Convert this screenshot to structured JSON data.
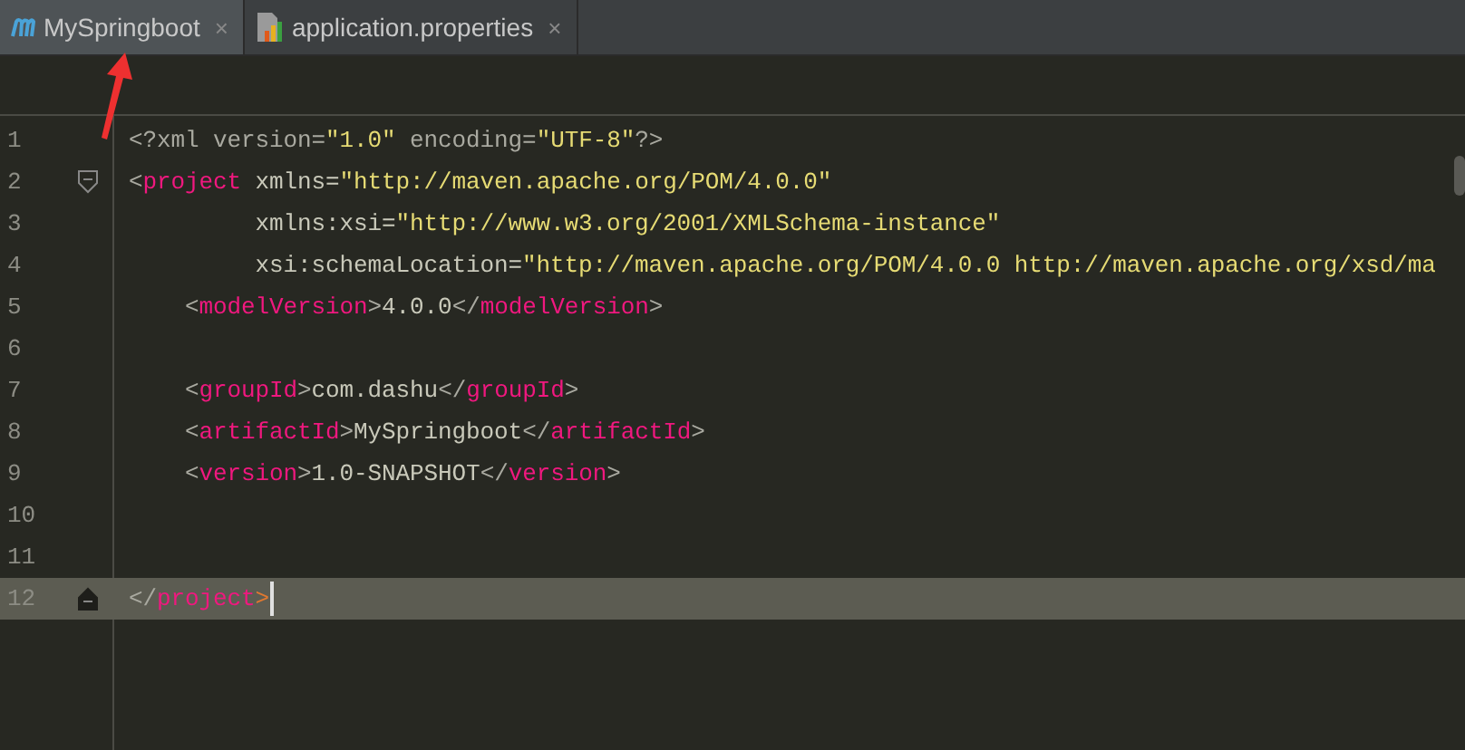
{
  "tabs": [
    {
      "label": "MySpringboot",
      "close": "×",
      "selected": true
    },
    {
      "label": "application.properties",
      "close": "×",
      "selected": false
    }
  ],
  "editor": {
    "lines": [
      {
        "number": "1",
        "current": false,
        "kind": "plain",
        "tokens": [
          {
            "kind": "punct",
            "text": "<?xml version="
          },
          {
            "kind": "string",
            "text": "\"1.0\""
          },
          {
            "kind": "punct",
            "text": " encoding="
          },
          {
            "kind": "string",
            "text": "\"UTF-8\""
          },
          {
            "kind": "punct",
            "text": "?>"
          }
        ]
      },
      {
        "number": "2",
        "current": false,
        "kind": "foldstart",
        "tokens": [
          {
            "kind": "punct",
            "text": "<"
          },
          {
            "kind": "tag",
            "text": "project"
          },
          {
            "kind": "attr",
            "text": " xmlns="
          },
          {
            "kind": "string",
            "text": "\"http://maven.apache.org/POM/4.0.0\""
          }
        ]
      },
      {
        "number": "3",
        "current": false,
        "kind": "plain",
        "tokens": [
          {
            "kind": "attr",
            "text": "         xmlns:xsi="
          },
          {
            "kind": "string",
            "text": "\"http://www.w3.org/2001/XMLSchema-instance\""
          }
        ]
      },
      {
        "number": "4",
        "current": false,
        "kind": "plain",
        "tokens": [
          {
            "kind": "attr",
            "text": "         xsi:schemaLocation="
          },
          {
            "kind": "string",
            "text": "\"http://maven.apache.org/POM/4.0.0 http://maven.apache.org/xsd/ma"
          }
        ]
      },
      {
        "number": "5",
        "current": false,
        "kind": "plain",
        "tokens": [
          {
            "kind": "punct",
            "text": "    <"
          },
          {
            "kind": "tag",
            "text": "modelVersion"
          },
          {
            "kind": "punct",
            "text": ">"
          },
          {
            "kind": "text",
            "text": "4.0.0"
          },
          {
            "kind": "punct",
            "text": "</"
          },
          {
            "kind": "tag",
            "text": "modelVersion"
          },
          {
            "kind": "punct",
            "text": ">"
          }
        ]
      },
      {
        "number": "6",
        "current": false,
        "kind": "plain"
      },
      {
        "number": "7",
        "current": false,
        "kind": "plain",
        "tokens": [
          {
            "kind": "punct",
            "text": "    <"
          },
          {
            "kind": "tag",
            "text": "groupId"
          },
          {
            "kind": "punct",
            "text": ">"
          },
          {
            "kind": "text",
            "text": "com.dashu"
          },
          {
            "kind": "punct",
            "text": "</"
          },
          {
            "kind": "tag",
            "text": "groupId"
          },
          {
            "kind": "punct",
            "text": ">"
          }
        ]
      },
      {
        "number": "8",
        "current": false,
        "kind": "plain",
        "tokens": [
          {
            "kind": "punct",
            "text": "    <"
          },
          {
            "kind": "tag",
            "text": "artifactId"
          },
          {
            "kind": "punct",
            "text": ">"
          },
          {
            "kind": "text",
            "text": "MySpringboot"
          },
          {
            "kind": "punct",
            "text": "</"
          },
          {
            "kind": "tag",
            "text": "artifactId"
          },
          {
            "kind": "punct",
            "text": ">"
          }
        ]
      },
      {
        "number": "9",
        "current": false,
        "kind": "plain",
        "tokens": [
          {
            "kind": "punct",
            "text": "    <"
          },
          {
            "kind": "tag",
            "text": "version"
          },
          {
            "kind": "punct",
            "text": ">"
          },
          {
            "kind": "text",
            "text": "1.0-SNAPSHOT"
          },
          {
            "kind": "punct",
            "text": "</"
          },
          {
            "kind": "tag",
            "text": "version"
          },
          {
            "kind": "punct",
            "text": ">"
          }
        ]
      },
      {
        "number": "10",
        "current": false,
        "kind": "plain"
      },
      {
        "number": "11",
        "current": false,
        "kind": "plain"
      },
      {
        "number": "12",
        "current": true,
        "kind": "foldend",
        "tokens": [
          {
            "kind": "punct",
            "text": "</"
          },
          {
            "kind": "tag",
            "text": "project"
          },
          {
            "kind": "bracket",
            "text": ">"
          }
        ]
      }
    ]
  }
}
